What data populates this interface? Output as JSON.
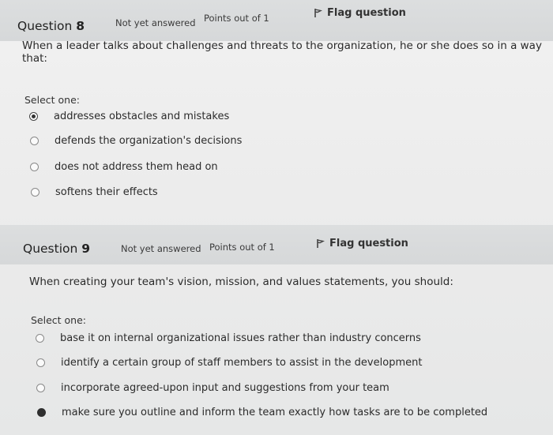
{
  "question8": {
    "label": "Question",
    "number": "8",
    "status": "Not yet answered",
    "points": "Points out of 1",
    "flag_label": "Flag question",
    "text": "When a leader talks about challenges and threats to the organization, he or she does so in a way that:",
    "select_label": "Select one:",
    "options": [
      {
        "label": "addresses obstacles and mistakes",
        "selected": true
      },
      {
        "label": "defends the organization's decisions",
        "selected": false
      },
      {
        "label": "does not address them head on",
        "selected": false
      },
      {
        "label": "softens their effects",
        "selected": false
      }
    ]
  },
  "question9": {
    "label": "Question",
    "number": "9",
    "status": "Not yet answered",
    "points": "Points out of 1",
    "flag_label": "Flag question",
    "text": "When creating your team's vision, mission, and values statements, you should:",
    "select_label": "Select one:",
    "options": [
      {
        "label": "base it on internal organizational issues rather than industry concerns",
        "selected": false
      },
      {
        "label": "identify a certain group of staff members to assist in the development",
        "selected": false
      },
      {
        "label": "incorporate agreed-upon input and suggestions from your team",
        "selected": false
      },
      {
        "label": "make sure you outline and inform the team exactly how tasks are to be completed",
        "selected": true
      }
    ]
  }
}
